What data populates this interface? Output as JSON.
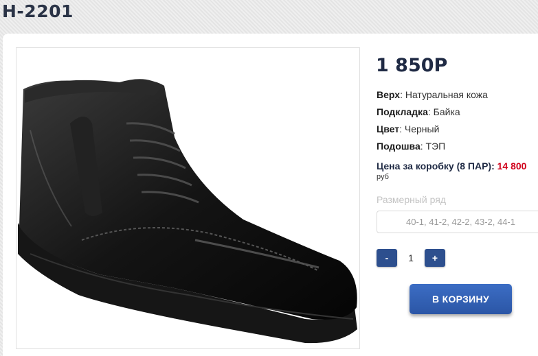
{
  "product": {
    "title": "H-2201",
    "price": "1 850Р",
    "image_alt": "shoe-image"
  },
  "specs": [
    {
      "label": "Верх",
      "value": ": Натуральная кожа"
    },
    {
      "label": "Подкладка",
      "value": ": Байка"
    },
    {
      "label": "Цвет",
      "value": ": Черный"
    },
    {
      "label": "Подошва",
      "value": ": ТЭП"
    }
  ],
  "box_price": {
    "label": "Цена за коробку (8 ПАР): ",
    "value": "14 800",
    "currency": "руб"
  },
  "sizes": {
    "label": "Размерный ряд",
    "value": "40-1, 41-2, 42-2, 43-2, 44-1"
  },
  "quantity": {
    "minus": "-",
    "value": "1",
    "plus": "+"
  },
  "cart_button": "В КОРЗИНУ",
  "colors": {
    "accent": "#2d4f8e",
    "price_red": "#d0021b",
    "title": "#2a3346"
  }
}
